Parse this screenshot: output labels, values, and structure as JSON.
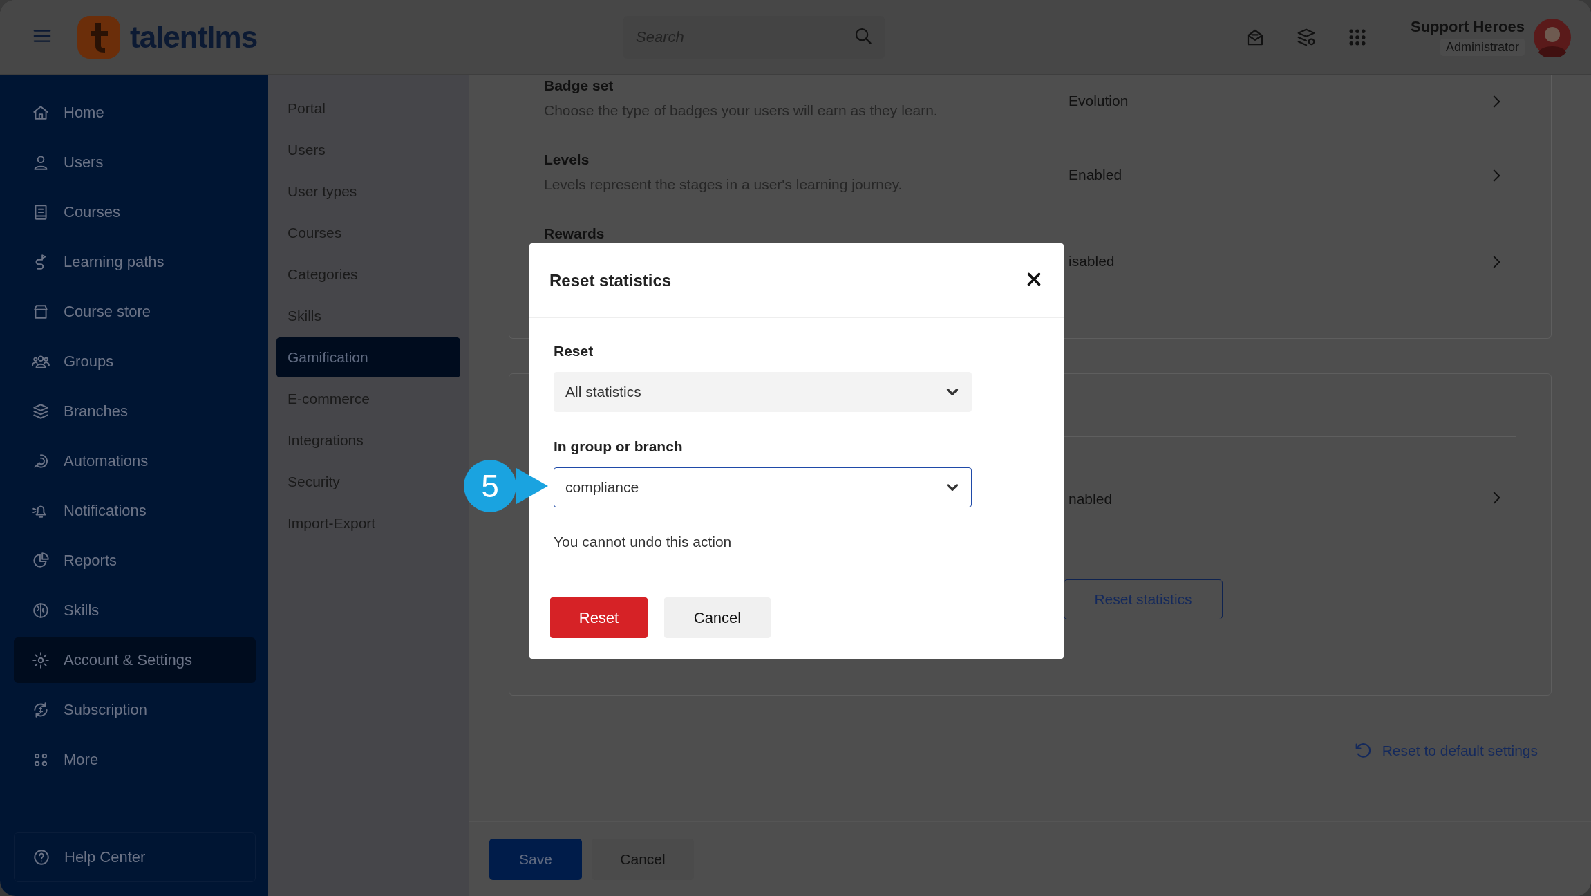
{
  "topbar": {
    "brand": "talentlms",
    "search": {
      "placeholder": "Search"
    },
    "user": {
      "name": "Support Heroes",
      "role": "Administrator"
    }
  },
  "sidebar": {
    "items": [
      {
        "label": "Home",
        "selected": false
      },
      {
        "label": "Users",
        "selected": false
      },
      {
        "label": "Courses",
        "selected": false
      },
      {
        "label": "Learning paths",
        "selected": false
      },
      {
        "label": "Course store",
        "selected": false
      },
      {
        "label": "Groups",
        "selected": false
      },
      {
        "label": "Branches",
        "selected": false
      },
      {
        "label": "Automations",
        "selected": false
      },
      {
        "label": "Notifications",
        "selected": false
      },
      {
        "label": "Reports",
        "selected": false
      },
      {
        "label": "Skills",
        "selected": false
      },
      {
        "label": "Account & Settings",
        "selected": true
      },
      {
        "label": "Subscription",
        "selected": false
      },
      {
        "label": "More",
        "selected": false
      }
    ],
    "help": "Help Center"
  },
  "settings_nav": {
    "items": [
      {
        "label": "Portal",
        "selected": false
      },
      {
        "label": "Users",
        "selected": false
      },
      {
        "label": "User types",
        "selected": false
      },
      {
        "label": "Courses",
        "selected": false
      },
      {
        "label": "Categories",
        "selected": false
      },
      {
        "label": "Skills",
        "selected": false
      },
      {
        "label": "Gamification",
        "selected": true
      },
      {
        "label": "E-commerce",
        "selected": false
      },
      {
        "label": "Integrations",
        "selected": false
      },
      {
        "label": "Security",
        "selected": false
      },
      {
        "label": "Import-Export",
        "selected": false
      }
    ]
  },
  "settings": [
    {
      "title": "Badge set",
      "description": "Choose the type of badges your users will earn as they learn.",
      "value": "Evolution"
    },
    {
      "title": "Levels",
      "description": "Levels represent the stages in a user's learning journey.",
      "value": "Enabled"
    },
    {
      "title": "Rewards",
      "value": "isabled"
    }
  ],
  "leaderboard": {
    "value": "nabled",
    "button": "Reset statistics"
  },
  "reset_defaults": "Reset to default settings",
  "footer": {
    "buttons": [
      {
        "label": "Save",
        "kind": "primary"
      },
      {
        "label": "Cancel",
        "kind": "secondary"
      }
    ]
  },
  "modal": {
    "title": "Reset statistics",
    "fields": [
      {
        "label": "Reset",
        "value": "All statistics",
        "focused": false
      },
      {
        "label": "In group or branch",
        "value": "compliance",
        "focused": true
      }
    ],
    "note": "You cannot undo this action",
    "buttons": [
      {
        "label": "Reset",
        "kind": "danger"
      },
      {
        "label": "Cancel",
        "kind": "secondary"
      }
    ]
  },
  "callout": {
    "number": "5"
  }
}
